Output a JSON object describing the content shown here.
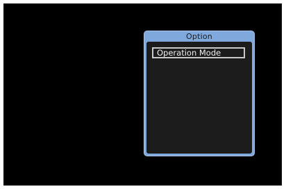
{
  "option_panel": {
    "title": "Option",
    "items": [
      {
        "label": "Operation Mode",
        "selected": true
      }
    ]
  },
  "colors": {
    "screen_background": "#000000",
    "panel_frame": "#7fa8dd",
    "panel_body": "#1c1c1c",
    "selection_border": "#c9c9c9"
  }
}
